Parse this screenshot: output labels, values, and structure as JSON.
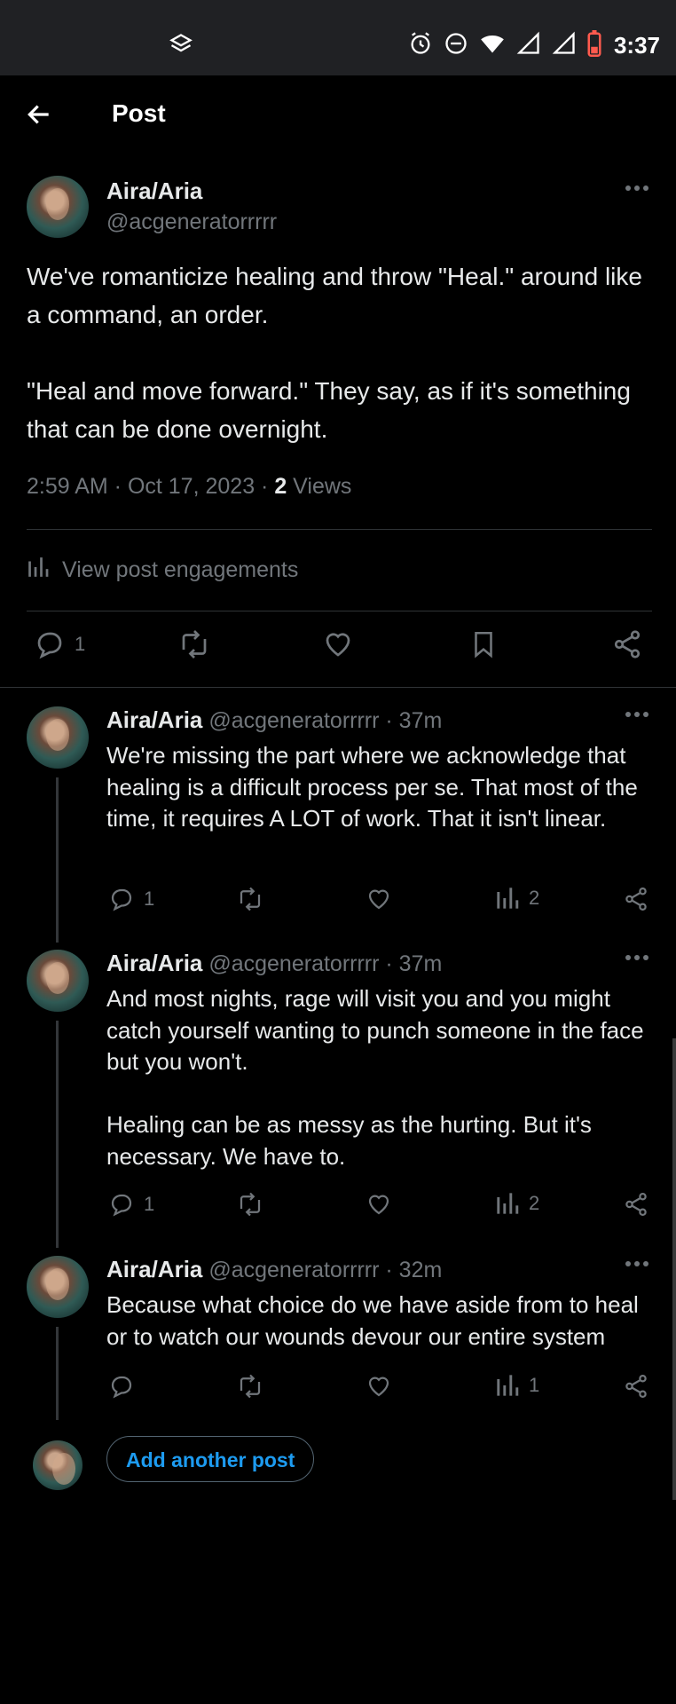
{
  "status_bar": {
    "time": "3:37",
    "icons": [
      "app-notification-icon",
      "alarm-icon",
      "do-not-disturb-icon",
      "wifi-icon",
      "signal-icon",
      "signal-icon",
      "battery-icon"
    ]
  },
  "header": {
    "title": "Post"
  },
  "main_post": {
    "name": "Aira/Aria",
    "handle": "@acgeneratorrrrr",
    "text": "We've romanticize healing and throw \"Heal.\" around like a command, an order.\n\n\"Heal and move forward.\" They say, as if it's something that can be done overnight.",
    "meta_prefix": "2:59 AM · Oct 17, 2023 · ",
    "views_count": "2",
    "views_label": " Views",
    "engagements_label": "View post engagements",
    "reply_count": "1"
  },
  "replies": [
    {
      "name": "Aira/Aria",
      "handle_time": "@acgeneratorrrrr · 37m",
      "text": "We're missing the part where we acknowledge that healing is a difficult process per se. That most of the time, it requires A LOT of work. That it isn't linear.",
      "reply_count": "1",
      "views": "2"
    },
    {
      "name": "Aira/Aria",
      "handle_time": "@acgeneratorrrrr · 37m",
      "text": "And most nights, rage will visit you and you might catch yourself wanting to punch someone in the face but you won't.\n\nHealing can be as messy as the hurting. But it's necessary. We have to.",
      "reply_count": "1",
      "views": "2"
    },
    {
      "name": "Aira/Aria",
      "handle_time": "@acgeneratorrrrr · 32m",
      "text": "Because what choice do we have aside from to heal or to watch our wounds devour our entire system",
      "reply_count": "",
      "views": "1"
    }
  ],
  "add_post": {
    "label": "Add another post"
  },
  "colors": {
    "background": "#000000",
    "text": "#e7e9ea",
    "muted": "#71767b",
    "accent": "#1d9bf0",
    "divider": "#2f3336"
  }
}
